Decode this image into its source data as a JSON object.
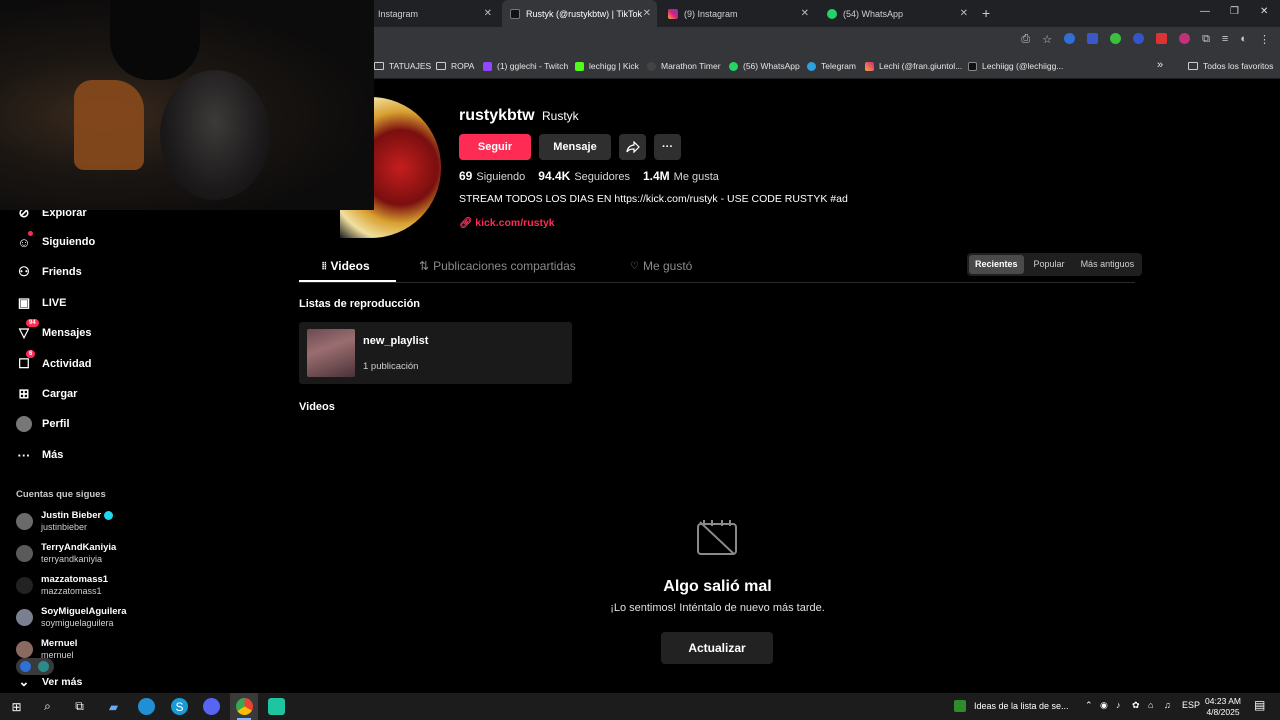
{
  "browser": {
    "tabs": [
      {
        "title": "Instagram"
      },
      {
        "title": "Rustyk (@rustykbtw) | TikTok"
      },
      {
        "title": "(9) Instagram"
      },
      {
        "title": "(54) WhatsApp"
      }
    ],
    "new_tab": "+",
    "bookmarks": [
      {
        "label": "TATUAJES"
      },
      {
        "label": "ROPA"
      },
      {
        "label": "(1) gglechi - Twitch"
      },
      {
        "label": "lechigg | Kick"
      },
      {
        "label": "Marathon Timer"
      },
      {
        "label": "(56) WhatsApp"
      },
      {
        "label": "Telegram"
      },
      {
        "label": "Lechi (@fran.giuntol..."
      },
      {
        "label": "Lechiigg (@lechiigg..."
      }
    ],
    "bookmarks_overflow": "»",
    "all_favorites": "Todos los favoritos"
  },
  "sidebar": {
    "nav": [
      {
        "label": "Explorar"
      },
      {
        "label": "Siguiendo"
      },
      {
        "label": "Friends"
      },
      {
        "label": "LIVE"
      },
      {
        "label": "Mensajes",
        "badge": "94"
      },
      {
        "label": "Actividad",
        "badge": "6"
      },
      {
        "label": "Cargar"
      },
      {
        "label": "Perfil"
      },
      {
        "label": "Más"
      }
    ],
    "follows_title": "Cuentas que sigues",
    "follows": [
      {
        "name": "Justin Bieber",
        "handle": "justinbieber",
        "verified": true
      },
      {
        "name": "TerryAndKaniyia",
        "handle": "terryandkaniyia"
      },
      {
        "name": "mazzatomass1",
        "handle": "mazzatomass1"
      },
      {
        "name": "SoyMiguelAguilera",
        "handle": "soymiguelaguilera"
      },
      {
        "name": "Mernuel",
        "handle": "mernuel"
      }
    ],
    "see_more": "Ver más"
  },
  "profile": {
    "username": "rustykbtw",
    "nickname": "Rustyk",
    "follow_label": "Seguir",
    "message_label": "Mensaje",
    "stats": {
      "following": "69",
      "following_label": "Siguiendo",
      "followers": "94.4K",
      "followers_label": "Seguidores",
      "likes": "1.4M",
      "likes_label": "Me gusta"
    },
    "bio": "STREAM TODOS LOS DIAS EN https://kick.com/rustyk - USE CODE RUSTYK #ad",
    "link": "kick.com/rustyk"
  },
  "content_tabs": {
    "videos": "Videos",
    "reposts": "Publicaciones compartidas",
    "liked": "Me gustó"
  },
  "sort": {
    "recent": "Recientes",
    "popular": "Popular",
    "oldest": "Más antiguos"
  },
  "playlists": {
    "title": "Listas de reproducción",
    "items": [
      {
        "name": "new_playlist",
        "count": "1 publicación"
      }
    ]
  },
  "videos_title": "Videos",
  "error": {
    "title": "Algo salió mal",
    "subtitle": "¡Lo sentimos! Inténtalo de nuevo más tarde.",
    "retry": "Actualizar"
  },
  "taskbar": {
    "news": "Ideas de la lista de se...",
    "language": "ESP",
    "time": "04:23 AM",
    "date": "4/8/2025"
  },
  "colors": {
    "accent": "#fe2c55",
    "background": "#000000"
  }
}
